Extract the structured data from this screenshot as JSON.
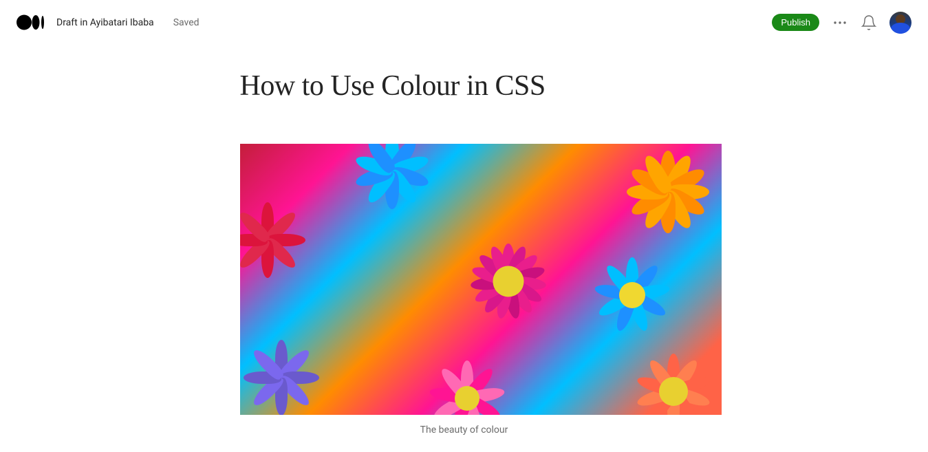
{
  "header": {
    "draft_location": "Draft in Ayibatari Ibaba",
    "save_status": "Saved",
    "publish_label": "Publish"
  },
  "article": {
    "title": "How to Use Colour in CSS",
    "image_caption": "The beauty of colour"
  }
}
